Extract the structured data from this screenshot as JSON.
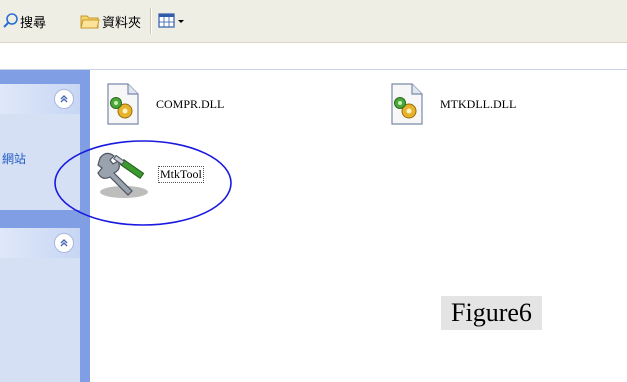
{
  "toolbar": {
    "search_label": "搜尋",
    "folders_label": "資料夾",
    "views_icon": "views-grid-icon"
  },
  "task_pane": {
    "panel1_link": "網站",
    "collapse_icon": "chevron-up-double-icon"
  },
  "files": [
    {
      "name": "COMPR.DLL",
      "icon": "dll-gear-icon"
    },
    {
      "name": "MTKDLL.DLL",
      "icon": "dll-gear-icon"
    },
    {
      "name": "MtkTool",
      "icon": "tools-wrench-icon"
    }
  ],
  "figure_caption": "Figure6",
  "colors": {
    "toolbar_bg": "#efeee5",
    "taskpane_bg": "#7f9ee3",
    "annotation_circle": "#1a1adf",
    "link": "#215dc6"
  }
}
